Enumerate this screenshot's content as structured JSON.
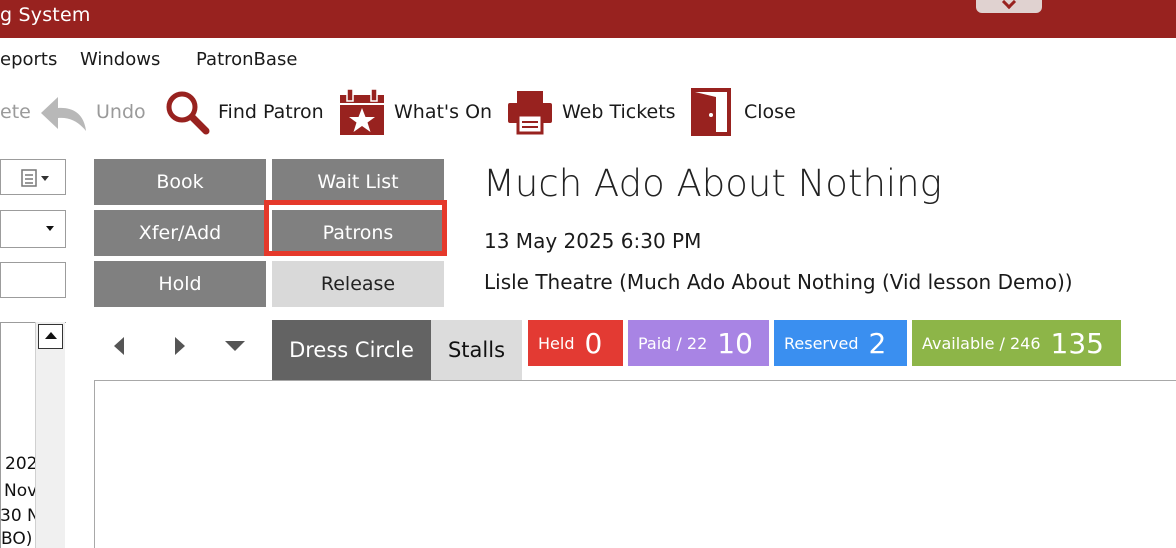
{
  "window": {
    "title": "g System"
  },
  "menu": [
    "eports",
    "Windows",
    "PatronBase"
  ],
  "toolbar": {
    "delete_label": "ete",
    "undo_label": "Undo",
    "find_patron_label": "Find Patron",
    "whats_on_label": "What's On",
    "web_tickets_label": "Web Tickets",
    "close_label": "Close"
  },
  "left_panel": {
    "list_lines": [
      "202",
      "Nov",
      "30 N",
      "BO)"
    ]
  },
  "actions": {
    "book": "Book",
    "wait_list": "Wait List",
    "xfer_add": "Xfer/Add",
    "patrons": "Patrons",
    "hold": "Hold",
    "release": "Release"
  },
  "event": {
    "title": "Much Ado About Nothing",
    "datetime": "13 May 2025 6:30 PM",
    "venue": "Lisle Theatre (Much Ado About Nothing (Vid lesson Demo))"
  },
  "tabs": [
    {
      "label": "Dress Circle",
      "active": true
    },
    {
      "label": "Stalls",
      "active": false
    }
  ],
  "badges": [
    {
      "label": "Held",
      "value": "0",
      "color": "#e33a33"
    },
    {
      "label": "Paid / 22",
      "value": "10",
      "color": "#a884e4"
    },
    {
      "label": "Reserved",
      "value": "2",
      "color": "#3a8ff0"
    },
    {
      "label": "Available / 246",
      "value": "135",
      "color": "#8db548"
    }
  ],
  "colors": {
    "titlebar": "#98221f",
    "highlight": "#e5392b"
  }
}
